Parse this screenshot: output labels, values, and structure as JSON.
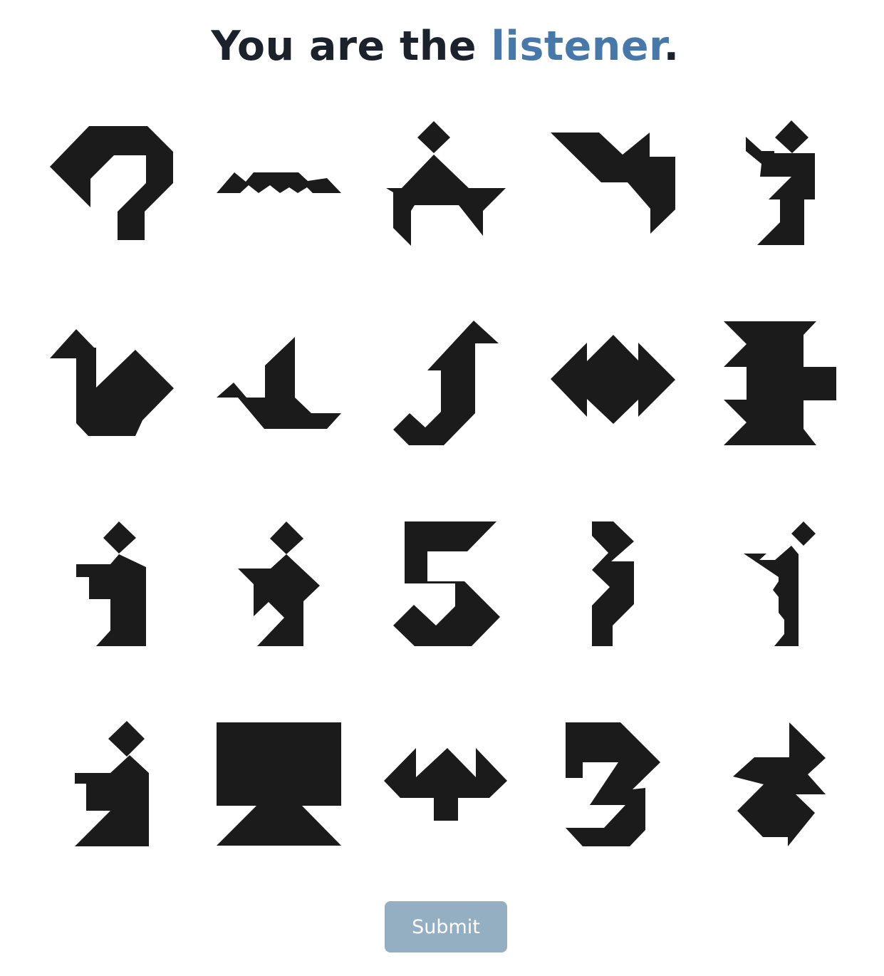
{
  "header": {
    "prefix": "You are the ",
    "role": "listener",
    "suffix": "."
  },
  "colors": {
    "role_accent": "#4678aa",
    "shape_fill": "#1b1b1b",
    "button_bg": "#94afc1"
  },
  "grid": {
    "rows": 4,
    "columns": 5,
    "tiles": [
      {
        "shape": "question-mark-shape"
      },
      {
        "shape": "wave-shape"
      },
      {
        "shape": "camel-shape"
      },
      {
        "shape": "swallow-shape"
      },
      {
        "shape": "kneeling-figure-shape"
      },
      {
        "shape": "duck-shape"
      },
      {
        "shape": "boat-shape"
      },
      {
        "shape": "crane-shape"
      },
      {
        "shape": "double-arrow-shape"
      },
      {
        "shape": "spool-shape"
      },
      {
        "shape": "sitting-figure-shape"
      },
      {
        "shape": "dancer-shape"
      },
      {
        "shape": "number-five-shape"
      },
      {
        "shape": "number-three-thin-shape"
      },
      {
        "shape": "bird-figure-shape"
      },
      {
        "shape": "seated-person-shape"
      },
      {
        "shape": "monitor-shape"
      },
      {
        "shape": "arrow-bird-shape"
      },
      {
        "shape": "number-three-shape"
      },
      {
        "shape": "fish-shape"
      }
    ]
  },
  "submit": {
    "label": "Submit"
  }
}
